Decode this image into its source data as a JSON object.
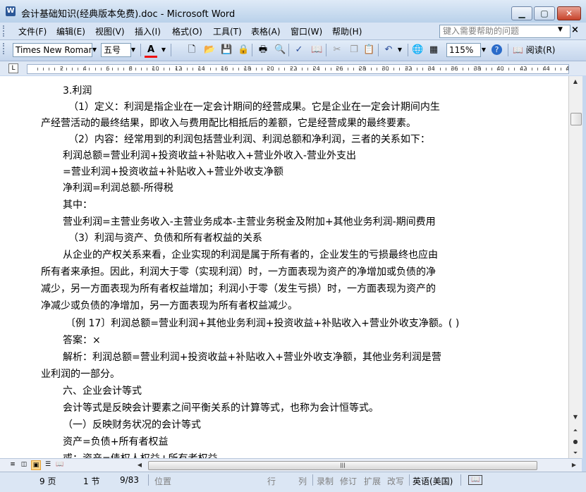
{
  "window": {
    "title": "会计基础知识(经典版本免费).doc - Microsoft Word",
    "app_icon": "W",
    "buttons": {
      "minimize": "▁",
      "maximize": "▢",
      "close": "✕"
    }
  },
  "menu": {
    "items": [
      "文件(F)",
      "编辑(E)",
      "视图(V)",
      "插入(I)",
      "格式(O)",
      "工具(T)",
      "表格(A)",
      "窗口(W)",
      "帮助(H)"
    ],
    "help_placeholder": "键入需要帮助的问题",
    "help_arrow": "▼",
    "doc_close": "×"
  },
  "toolbar": {
    "font_name": "Times New Roman",
    "font_size": "五号",
    "font_color_label": "A",
    "zoom": "115%",
    "read_label": "阅读(R)",
    "icons": [
      "new-doc-icon",
      "open-icon",
      "save-icon",
      "permission-icon",
      "print-icon",
      "print-preview-icon",
      "spelling-icon",
      "research-icon",
      "cut-icon",
      "copy-icon",
      "paste-icon",
      "undo-icon",
      "insert-hyperlink-icon",
      "tables-borders-icon",
      "help-icon"
    ]
  },
  "ruler": {
    "corner": "L",
    "labels": [
      "2",
      "4",
      "6",
      "8",
      "10",
      "12",
      "14",
      "16",
      "18",
      "20",
      "22",
      "24",
      "26",
      "28",
      "30",
      "32",
      "34",
      "36",
      "38",
      "40",
      "42",
      "44",
      "46"
    ]
  },
  "document": {
    "lines": [
      "3.利润",
      "（1）定义：利润是指企业在一定会计期间的经营成果。它是企业在一定会计期间内生",
      "产经营活动的最终结果，即收入与费用配比相抵后的差额，它是经营成果的最终要素。",
      "（2）内容：经常用到的利润包括营业利润、利润总额和净利润，三者的关系如下：",
      "利润总额=营业利润+投资收益+补贴收入+营业外收入-营业外支出",
      "=营业利润+投资收益+补贴收入+营业外收支净额",
      "净利润=利润总额-所得税",
      "其中：",
      "营业利润=主营业务收入-主营业务成本-主营业务税金及附加+其他业务利润-期间费用",
      "（3）利润与资产、负债和所有者权益的关系",
      "从企业的产权关系来看，企业实现的利润是属于所有者的，企业发生的亏损最终也应由",
      "所有者来承担。因此，利润大于零（实现利润）时，一方面表现为资产的净增加或负债的净",
      "减少，另一方面表现为所有者权益增加；利润小于零（发生亏损）时，一方面表现为资产的",
      "净减少或负债的净增加，另一方面表现为所有者权益减少。",
      "〔例 17〕利润总额=营业利润+其他业务利润+投资收益+补贴收入+营业外收支净额。( )",
      "答案：×",
      "解析：利润总额=营业利润+投资收益+补贴收入+营业外收支净额，其他业务利润是营",
      "业利润的一部分。",
      "六、企业会计等式",
      "会计等式是反映会计要素之间平衡关系的计算等式，也称为会计恒等式。",
      "（一）反映财务状况的会计等式",
      "资产=负债+所有者权益",
      "或：资产=债权人权益+所有者权益"
    ]
  },
  "status": {
    "page": "9 页",
    "section": "1 节",
    "page_of": "9/83",
    "position": "位置",
    "line": "行",
    "column": "列",
    "rec": "录制",
    "trk": "修订",
    "ext": "扩展",
    "ovr": "改写",
    "language": "英语(美国)"
  }
}
